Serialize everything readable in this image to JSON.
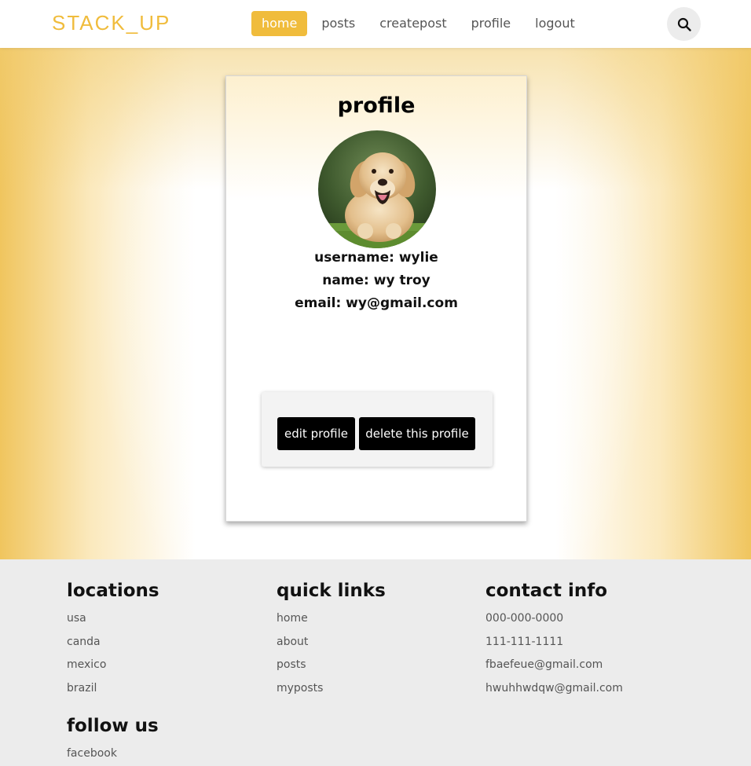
{
  "nav": {
    "logo": "STACK_UP",
    "links": [
      "home",
      "posts",
      "createpost",
      "profile",
      "logout"
    ],
    "active_link": "home",
    "search_icon": "search-icon"
  },
  "profile": {
    "title": "profile",
    "avatar": "golden-retriever-photo",
    "username_line": "username: wylie",
    "name_line": "name: wy troy",
    "email_line": "email: wy@gmail.com",
    "edit_label": "edit profile",
    "delete_label": "delete this profile"
  },
  "footer": {
    "locations": {
      "heading": "locations",
      "items": [
        "usa",
        "canda",
        "mexico",
        "brazil"
      ]
    },
    "quick_links": {
      "heading": "quick links",
      "items": [
        "home",
        "about",
        "posts",
        "myposts"
      ]
    },
    "contact": {
      "heading": "contact info",
      "items": [
        "000-000-0000",
        "111-111-1111",
        "fbaefeue@gmail.com",
        "hwuhhwdqw@gmail.com"
      ]
    },
    "follow": {
      "heading": "follow us",
      "items": [
        "facebook"
      ]
    }
  },
  "colors": {
    "brand": "#f0bc3c",
    "button": "#000000",
    "footer_bg": "#ececec"
  }
}
